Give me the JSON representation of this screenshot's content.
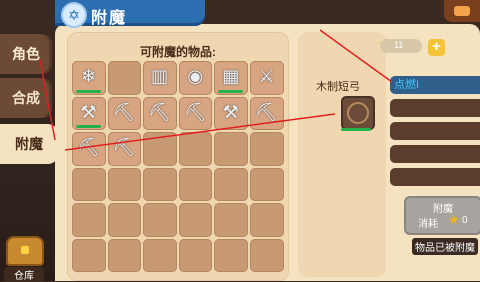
{
  "title": "附魔",
  "sidebar": {
    "tabs": [
      "角色",
      "合成",
      "附魔"
    ],
    "active_index": 2,
    "warehouse_label": "仓库"
  },
  "inventory": {
    "title": "可附魔的物品:",
    "rows": 6,
    "cols": 6,
    "items": [
      {
        "name": "ice-boots-icon",
        "equipped": true
      },
      {
        "name": "empty",
        "equipped": false
      },
      {
        "name": "purple-pants-icon",
        "equipped": false
      },
      {
        "name": "ice-helmet-icon",
        "equipped": false
      },
      {
        "name": "green-armor-icon",
        "equipped": true
      },
      {
        "name": "sword-icon",
        "equipped": false
      },
      {
        "name": "axe-icon",
        "equipped": true
      },
      {
        "name": "pickaxe-icon",
        "equipped": false
      },
      {
        "name": "pickaxe-icon",
        "equipped": false
      },
      {
        "name": "pickaxe-icon",
        "equipped": false
      },
      {
        "name": "axe-icon",
        "equipped": false
      },
      {
        "name": "pickaxe-icon",
        "equipped": false
      },
      {
        "name": "pickaxe-icon",
        "equipped": false
      },
      {
        "name": "pickaxe-icon",
        "equipped": false
      }
    ]
  },
  "selected_item": {
    "name": "木制短弓",
    "equipped": true
  },
  "currency": {
    "stars": "11"
  },
  "enchant_slots": [
    "点燃I",
    "",
    "",
    "",
    ""
  ],
  "enchant_button": {
    "label": "附魔",
    "cost_label": "消耗",
    "cost_value": "0"
  },
  "notice": "物品已被附魔"
}
